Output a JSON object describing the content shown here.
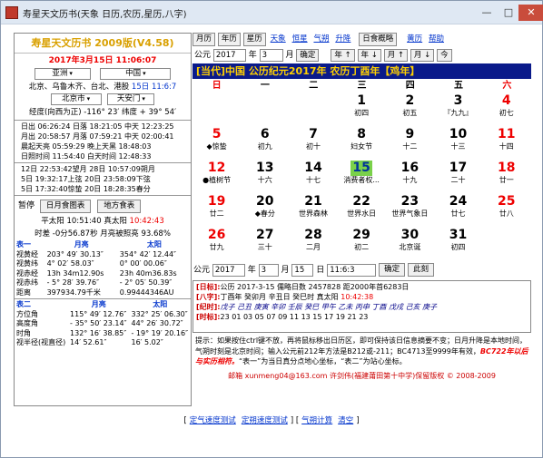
{
  "window": {
    "title": "寿星天文历书(天象 日历,农历,星历,八字)",
    "min": "—",
    "max": "□",
    "close": "✕"
  },
  "left": {
    "brand": "寿星天文历书 2009版(V4.58)",
    "datetime": "2017年3月15日 11:06:07",
    "region": "亚洲",
    "country": "中国",
    "cities": "北京、乌鲁木齐、台北、港股",
    "cities_day": "15日",
    "cities_time": "11:6:7",
    "province": "北京市",
    "district": "天安门",
    "coords": "经度(向西为正) -116° 23′ 纬度 + 39° 54′",
    "sun_rows": [
      "日出 06:26:24 日落 18:21:05 中天 12:23:25",
      "月出 20:58:57 月落 07:59:21 中天 02:00:41",
      "晨起天亮 05:59:29 晚上天黑 18:48:03",
      "日照时间 11:54:40 白天时间 12:48:33"
    ],
    "phase_rows": [
      "12日 22:53:42望月 28日 10:57:09朔月",
      " 5日 19:32:17上弦 20日 23:58:09下弦",
      " 5日 17:32:40惊蛰 20日 18:28:35春分"
    ],
    "pause": "暂停",
    "btn_eclipse": "日月食图表",
    "btn_topo": "地方食表",
    "ptime": "平太阳 10:51:40 真太阳",
    "ptime_val": "10:42:43",
    "jd": "时差 -0分56.87秒 月亮被照亮 93.68%",
    "table1": {
      "h": [
        "表一",
        "月亮",
        "太阳"
      ],
      "rows": [
        [
          "视黄经",
          "203° 49′ 30.13″",
          "354° 42′ 12.44″"
        ],
        [
          "视黄纬",
          "4° 02′ 58.03″",
          "0° 00′ 00.06″"
        ],
        [
          "视赤经",
          "13h 34m12.90s",
          "23h 40m36.83s"
        ],
        [
          "视赤纬",
          "- 5° 28′ 39.76″",
          "- 2° 05′ 50.39″"
        ],
        [
          "距离",
          "397934.79千米",
          "0.99444346AU"
        ]
      ]
    },
    "table2": {
      "h": [
        "表二",
        "月亮",
        "太阳"
      ],
      "rows": [
        [
          "方位角",
          "115° 49′ 12.76″",
          "332° 25′ 06.30″"
        ],
        [
          "高度角",
          "- 35° 50′ 23.14″",
          "44° 26′ 30.72″"
        ],
        [
          "时角",
          "132° 16′ 38.85″",
          "- 19° 19′ 20.16″"
        ],
        [
          "视半径(视直径)",
          "14′ 52.61″",
          "16′ 5.02″"
        ]
      ]
    }
  },
  "right": {
    "tabs": [
      "月历",
      "年历",
      "星历"
    ],
    "links": [
      "天象",
      "恒星",
      "气朔",
      "升降"
    ],
    "btn_eclipse": "日食概略",
    "links2": [
      "黄历",
      "帮助"
    ],
    "year_label": "公元",
    "year": "2017",
    "year_unit": "年",
    "month": "3",
    "month_unit": "月",
    "ok": "确定",
    "nav": [
      "年 ↑",
      "年 ↓",
      "月 ↑",
      "月 ↓",
      "今"
    ],
    "banner": "[当代]中国 公历纪元2017年 农历丁酉年【鸡年】",
    "weekdays": [
      "日",
      "一",
      "二",
      "三",
      "四",
      "五",
      "六"
    ],
    "cells": [
      {
        "d": "",
        "l": ""
      },
      {
        "d": "",
        "l": ""
      },
      {
        "d": "",
        "l": ""
      },
      {
        "d": "1",
        "l": "初四"
      },
      {
        "d": "2",
        "l": "初五"
      },
      {
        "d": "3",
        "l": "『九九』"
      },
      {
        "d": "4",
        "l": "初七",
        "red": true
      },
      {
        "d": "5",
        "l": "◆惊蛰",
        "red": true
      },
      {
        "d": "6",
        "l": "初九"
      },
      {
        "d": "7",
        "l": "初十"
      },
      {
        "d": "8",
        "l": "妇女节"
      },
      {
        "d": "9",
        "l": "十二"
      },
      {
        "d": "10",
        "l": "十三"
      },
      {
        "d": "11",
        "l": "十四",
        "red": true
      },
      {
        "d": "12",
        "l": "●植树节",
        "red": true
      },
      {
        "d": "13",
        "l": "十六"
      },
      {
        "d": "14",
        "l": "十七"
      },
      {
        "d": "15",
        "l": "消费者权...",
        "today": true
      },
      {
        "d": "16",
        "l": "十九"
      },
      {
        "d": "17",
        "l": "二十"
      },
      {
        "d": "18",
        "l": "廿一",
        "red": true
      },
      {
        "d": "19",
        "l": "廿二",
        "red": true
      },
      {
        "d": "20",
        "l": "◆春分"
      },
      {
        "d": "21",
        "l": "世界森林"
      },
      {
        "d": "22",
        "l": "世界水日"
      },
      {
        "d": "23",
        "l": "世界气象日"
      },
      {
        "d": "24",
        "l": "廿七"
      },
      {
        "d": "25",
        "l": "廿八",
        "red": true
      },
      {
        "d": "26",
        "l": "廿九",
        "red": true
      },
      {
        "d": "27",
        "l": "三十"
      },
      {
        "d": "28",
        "l": "二月"
      },
      {
        "d": "29",
        "l": "初二"
      },
      {
        "d": "30",
        "l": "北京诞"
      },
      {
        "d": "31",
        "l": "初四"
      },
      {
        "d": "",
        "l": ""
      }
    ],
    "q_label": "公元",
    "q_year": "2017",
    "q_year_unit": "年",
    "q_month": "3",
    "q_month_unit": "月",
    "q_day": "15",
    "q_day_unit": "日",
    "q_time": "11:6:3",
    "q_ok": "确定",
    "q_now": "此刻",
    "info": [
      {
        "k": "[日标]:",
        "v": "公历 2017-3-15 儒略日数 2457828 距2000年首6283日"
      },
      {
        "k": "[八字]:",
        "v": "丁酉年 癸卯月 辛丑日 癸巳时 真太阳 ",
        "t": "10:42:38"
      },
      {
        "k": "[纪时]:",
        "v": "戊子 己丑 庚寅 辛卯 壬辰 癸巳 甲午 乙未 丙申 丁酉 戊戌 己亥 庚子"
      },
      {
        "k": "[时标]:",
        "v": "23  01  03  05  07  09  11  13  15  17  19  21  23"
      }
    ],
    "note_a": "提示：如果按住ctrl键不放，再将鼠标移出日历区，即可保持该日信息摘要不变；日月升降是本地时间，气朔时刻是北京时间；输入公元前212年方法是B212或-211；BC4713至9999年有效，",
    "note_b": "BC722年以后与实历相符。",
    "note_c": "“表一”为当日真分点地心坐标，“表二”为站心坐标。",
    "footer": "邮箱 xunmeng04@163.com 许剑伟(福建莆田第十中学)保留版权 © 2008-2009"
  },
  "bottom_links": [
    "定气速度测试",
    "定朔速度测试",
    "气朔计算",
    "清空"
  ],
  "watermark": "JSSU下载"
}
